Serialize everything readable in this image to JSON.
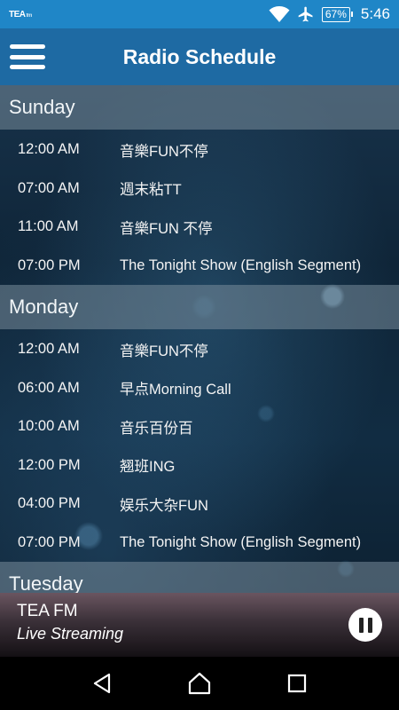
{
  "status_bar": {
    "app_label": "TEA",
    "app_label_suffix": "fm",
    "battery": "67%",
    "time": "5:46"
  },
  "app_bar": {
    "title": "Radio Schedule"
  },
  "schedule": [
    {
      "day": "Sunday",
      "shows": [
        {
          "time": "12:00 AM",
          "name": "音樂FUN不停"
        },
        {
          "time": "07:00 AM",
          "name": "週末粘TT"
        },
        {
          "time": "11:00 AM",
          "name": "音樂FUN 不停"
        },
        {
          "time": "07:00 PM",
          "name": "The Tonight Show (English Segment)"
        }
      ]
    },
    {
      "day": "Monday",
      "shows": [
        {
          "time": "12:00 AM",
          "name": "音樂FUN不停"
        },
        {
          "time": "06:00 AM",
          "name": "早点Morning Call"
        },
        {
          "time": "10:00 AM",
          "name": "音乐百份百"
        },
        {
          "time": "12:00 PM",
          "name": "翘班ING"
        },
        {
          "time": "04:00 PM",
          "name": "娱乐大杂FUN"
        },
        {
          "time": "07:00 PM",
          "name": "The Tonight Show (English Segment)"
        }
      ]
    },
    {
      "day": "Tuesday",
      "shows": []
    }
  ],
  "player": {
    "station": "TEA FM",
    "status": "Live Streaming"
  },
  "colors": {
    "status_bar": "#1f86c7",
    "app_bar": "#1e6aa3"
  }
}
